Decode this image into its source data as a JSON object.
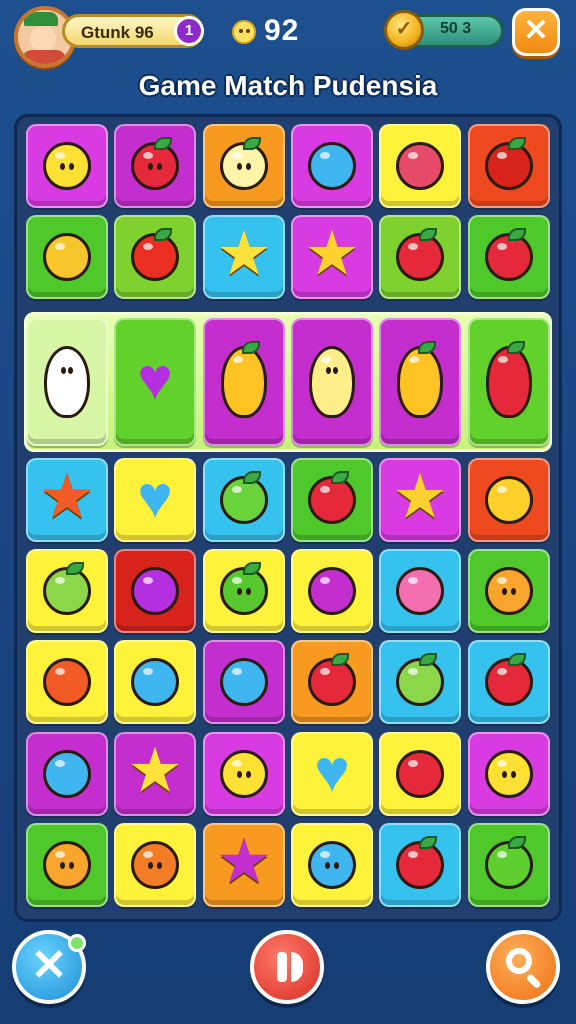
{
  "header": {
    "player_name": "Gtunk 96",
    "level": "1",
    "moves": "92",
    "coins": "50 3",
    "close_symbol": "✕"
  },
  "title": "Game Match Pudensia",
  "board": {
    "rows": 8,
    "cols": 6,
    "highlighted_row": 2,
    "tiles": [
      [
        {
          "bg": "#d93be2",
          "piece": "lemon",
          "color": "#ffe133"
        },
        {
          "bg": "#c42ecf",
          "piece": "apple",
          "color": "#e5283a"
        },
        {
          "bg": "#f79a1f",
          "piece": "radish",
          "color": "#fff4a8"
        },
        {
          "bg": "#d93be2",
          "piece": "ball",
          "color": "#3fb6f0"
        },
        {
          "bg": "#fff23a",
          "piece": "drop",
          "color": "#e84a6a"
        },
        {
          "bg": "#ef4a1f",
          "piece": "pepper",
          "color": "#d8231d"
        }
      ],
      [
        {
          "bg": "#4fc82b",
          "piece": "cracker",
          "color": "#f7c52c"
        },
        {
          "bg": "#7ed12f",
          "piece": "apple",
          "color": "#ea2f22"
        },
        {
          "bg": "#36c2ef",
          "piece": "star",
          "color": "#ffe23a"
        },
        {
          "bg": "#d93be2",
          "piece": "star",
          "color": "#ffd12f"
        },
        {
          "bg": "#7ed12f",
          "piece": "apple",
          "color": "#e5283a"
        },
        {
          "bg": "#4fc82b",
          "piece": "apple",
          "color": "#e5283a"
        }
      ],
      [
        {
          "bg": "#d8f7a6",
          "piece": "icecream",
          "color": "#ffffff"
        },
        {
          "bg": "#63d12c",
          "piece": "heart",
          "color": "#b42fe0"
        },
        {
          "bg": "#c42ecf",
          "piece": "carrot",
          "color": "#ffc424"
        },
        {
          "bg": "#c42ecf",
          "piece": "icecream",
          "color": "#ffef8a"
        },
        {
          "bg": "#c42ecf",
          "piece": "carrot",
          "color": "#ffc424"
        },
        {
          "bg": "#63d12c",
          "piece": "strawberry",
          "color": "#e5283a"
        }
      ],
      [
        {
          "bg": "#36c2ef",
          "piece": "star",
          "color": "#f25a26"
        },
        {
          "bg": "#fff23a",
          "piece": "heart",
          "color": "#3fb6f0"
        },
        {
          "bg": "#36c2ef",
          "piece": "lime",
          "color": "#6ad23a"
        },
        {
          "bg": "#4fc82b",
          "piece": "apple",
          "color": "#e5283a"
        },
        {
          "bg": "#d93be2",
          "piece": "star",
          "color": "#ffd12f"
        },
        {
          "bg": "#ef4a1f",
          "piece": "clock",
          "color": "#ffcf2a"
        }
      ],
      [
        {
          "bg": "#fff23a",
          "piece": "lime",
          "color": "#8cd64a"
        },
        {
          "bg": "#d8231d",
          "piece": "candy",
          "color": "#b42fe0"
        },
        {
          "bg": "#fff23a",
          "piece": "apple",
          "color": "#58c82f"
        },
        {
          "bg": "#fff23a",
          "piece": "gift",
          "color": "#c42ecf"
        },
        {
          "bg": "#36c2ef",
          "piece": "swirl",
          "color": "#f46fb0"
        },
        {
          "bg": "#4fc82b",
          "piece": "cat",
          "color": "#f7a52c"
        }
      ],
      [
        {
          "bg": "#fff23a",
          "piece": "eyeball",
          "color": "#f25a26"
        },
        {
          "bg": "#fff23a",
          "piece": "bird",
          "color": "#3fb6f0"
        },
        {
          "bg": "#c42ecf",
          "piece": "ball",
          "color": "#3fb6f0"
        },
        {
          "bg": "#f79a1f",
          "piece": "apple",
          "color": "#e5283a"
        },
        {
          "bg": "#36c2ef",
          "piece": "apple",
          "color": "#8cd64a"
        },
        {
          "bg": "#36c2ef",
          "piece": "apple",
          "color": "#e5283a"
        }
      ],
      [
        {
          "bg": "#c42ecf",
          "piece": "ball",
          "color": "#3fb6f0"
        },
        {
          "bg": "#c42ecf",
          "piece": "star",
          "color": "#ffe23a"
        },
        {
          "bg": "#d93be2",
          "piece": "monster",
          "color": "#ffe133"
        },
        {
          "bg": "#fff23a",
          "piece": "heart",
          "color": "#3fb6f0"
        },
        {
          "bg": "#fff23a",
          "piece": "cake",
          "color": "#e5283a"
        },
        {
          "bg": "#d93be2",
          "piece": "cat",
          "color": "#ffe133"
        }
      ],
      [
        {
          "bg": "#4fc82b",
          "piece": "bear",
          "color": "#f7a52c"
        },
        {
          "bg": "#fff23a",
          "piece": "bear",
          "color": "#f27d26"
        },
        {
          "bg": "#f79a1f",
          "piece": "star",
          "color": "#c42ecf"
        },
        {
          "bg": "#fff23a",
          "piece": "monster",
          "color": "#3fb6f0"
        },
        {
          "bg": "#36c2ef",
          "piece": "apple",
          "color": "#e5283a"
        },
        {
          "bg": "#4fc82b",
          "piece": "pepper",
          "color": "#5fcf2f"
        }
      ]
    ]
  },
  "buttons": {
    "shuffle_symbol": "✕"
  }
}
